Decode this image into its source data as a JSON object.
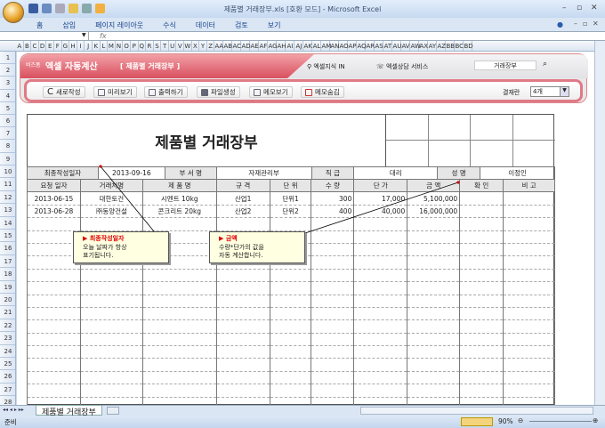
{
  "window": {
    "title": "제품별 거래장부.xls  [호환 모드] - Microsoft Excel"
  },
  "ribbon": {
    "tabs": [
      "홈",
      "삽입",
      "페이지 레이아웃",
      "수식",
      "데이터",
      "검토",
      "보기"
    ]
  },
  "formula_bar": {
    "fx": "fx",
    "value": ""
  },
  "columns": [
    "A",
    "B",
    "C",
    "D",
    "E",
    "F",
    "G",
    "H",
    "I",
    "J",
    "K",
    "L",
    "M",
    "N",
    "O",
    "P",
    "Q",
    "R",
    "S",
    "T",
    "U",
    "V",
    "W",
    "X",
    "Y",
    "Z",
    "AA",
    "AB",
    "AC",
    "AD",
    "AE",
    "AF",
    "AG",
    "AH",
    "AI",
    "AJ",
    "AK",
    "AL",
    "AM",
    "AN",
    "AO",
    "AP",
    "AQ",
    "AR",
    "AS",
    "AT",
    "AU",
    "AV",
    "AW",
    "AX",
    "AY",
    "AZ",
    "BB",
    "BC",
    "BD"
  ],
  "banner": {
    "brand": "비즈폼",
    "app": "엑셀 자동계산",
    "doc": "[ 제품별 거래장부 ]",
    "link1": "엑셀지식 IN",
    "link2": "엑셀상담 서비스",
    "search": "거래장부"
  },
  "toolbar": {
    "buttons": [
      "새로작성",
      "미리보기",
      "출력하기",
      "파일생성",
      "메모보기",
      "메모숨김"
    ],
    "approval_label": "결재란",
    "approval_value": "4개"
  },
  "report": {
    "title": "제품별 거래장부",
    "info": {
      "date_label": "최종작성일자",
      "date": "2013-09-16",
      "dept_label": "부 서 명",
      "dept": "자재관리부",
      "rank_label": "직 급",
      "rank": "대리",
      "name_label": "성 명",
      "name": "이정인"
    },
    "headers": [
      "요청 일자",
      "거래처명",
      "제 품 명",
      "규 격",
      "단 위",
      "수 량",
      "단 가",
      "금 액",
      "확 인",
      "비 고"
    ],
    "rows": [
      [
        "2013-06-15",
        "대한토건",
        "시멘트 10kg",
        "산업1",
        "단위1",
        "300",
        "17,000",
        "5,100,000",
        "",
        ""
      ],
      [
        "2013-06-28",
        "㈜동양건설",
        "콘크리트 20kg",
        "산업2",
        "단위2",
        "400",
        "40,000",
        "16,000,000",
        "",
        ""
      ]
    ]
  },
  "comments": [
    {
      "title": "최종작성일자",
      "text1": "오늘 날짜가 항상",
      "text2": "표기됩니다."
    },
    {
      "title": "금액",
      "text1": "수량*단가의 값을",
      "text2": "자동 계산합니다."
    }
  ],
  "sheet_tab": "제품별 거래장부",
  "status": {
    "ready": "준비",
    "zoom": "90%"
  }
}
